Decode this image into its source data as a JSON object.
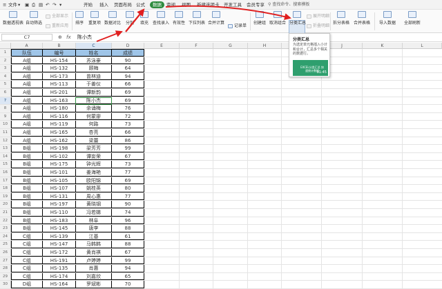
{
  "menubar": {
    "items": [
      "文件",
      "开始",
      "插入",
      "页面布局",
      "公式",
      "数据",
      "审阅",
      "视图",
      "新建选项卡",
      "开发工具",
      "会员专享"
    ],
    "active": "数据",
    "search_text": "查找命令、搜索模板"
  },
  "ribbon": {
    "buttons": [
      "数据透视表",
      "自动筛选",
      "全部显示",
      "重新应用",
      "排序",
      "重复项",
      "数据对比",
      "分列",
      "填充",
      "查找录入",
      "有效性",
      "下拉列表",
      "合并计算",
      "记录单",
      "创建组",
      "取消组合",
      "分类汇总",
      "展开明细",
      "折叠明细",
      "拆分表格",
      "合并表格",
      "导入数据",
      "全部刷新"
    ]
  },
  "formula": {
    "name_box": "C7",
    "fx": "fx",
    "value": "陈小杰"
  },
  "columns": [
    "A",
    "B",
    "C",
    "D",
    "E",
    "F",
    "G",
    "H",
    "I",
    "J",
    "K",
    "L"
  ],
  "table": {
    "headers": [
      "队伍",
      "编号",
      "姓名",
      "成绩"
    ],
    "rows": [
      [
        "A组",
        "HS-154",
        "苏泳豪",
        "90"
      ],
      [
        "A组",
        "HS-132",
        "顾梅",
        "64"
      ],
      [
        "A组",
        "HS-173",
        "曾林迪",
        "94"
      ],
      [
        "A组",
        "HS-113",
        "于姜仪",
        "66"
      ],
      [
        "A组",
        "HS-201",
        "谭新韵",
        "69"
      ],
      [
        "A组",
        "HS-163",
        "陈小杰",
        "69"
      ],
      [
        "A组",
        "HS-180",
        "余诵梅",
        "76"
      ],
      [
        "A组",
        "HS-116",
        "何蒙廖",
        "72"
      ],
      [
        "A组",
        "HS-119",
        "何路",
        "73"
      ],
      [
        "A组",
        "HS-165",
        "杏亮",
        "66"
      ],
      [
        "A组",
        "HS-162",
        "梁蕾",
        "86"
      ],
      [
        "B组",
        "HS-198",
        "梁芳芳",
        "99"
      ],
      [
        "B组",
        "HS-102",
        "谭妄荣",
        "67"
      ],
      [
        "B组",
        "HS-175",
        "钟光辉",
        "73"
      ],
      [
        "B组",
        "HS-101",
        "姜海艳",
        "77"
      ],
      [
        "B组",
        "HS-105",
        "欧阳锦",
        "69"
      ],
      [
        "B组",
        "HS-107",
        "姚桂英",
        "80"
      ],
      [
        "B组",
        "HS-131",
        "周心惠",
        "77"
      ],
      [
        "B组",
        "HS-197",
        "黄晓钢",
        "90"
      ],
      [
        "B组",
        "HS-110",
        "冯若娣",
        "74"
      ],
      [
        "B组",
        "HS-183",
        "林阜",
        "96"
      ],
      [
        "B组",
        "HS-145",
        "唐李",
        "88"
      ],
      [
        "C组",
        "HS-139",
        "江基",
        "61"
      ],
      [
        "C组",
        "HS-147",
        "马韩韩",
        "88"
      ],
      [
        "C组",
        "HS-172",
        "黄肖祺",
        "67"
      ],
      [
        "C组",
        "HS-191",
        "卢婷婷",
        "99"
      ],
      [
        "C组",
        "HS-135",
        "肖惠",
        "94"
      ],
      [
        "C组",
        "HS-174",
        "刘嘉欣",
        "65"
      ],
      [
        "D组",
        "HS-164",
        "罗斌彬",
        "70"
      ]
    ]
  },
  "row_numbers": [
    "1",
    "2",
    "3",
    "4",
    "5",
    "6",
    "7",
    "8",
    "9",
    "10",
    "11",
    "12",
    "13",
    "14",
    "15",
    "16",
    "17",
    "18",
    "19",
    "20",
    "21",
    "22",
    "23",
    "24",
    "25",
    "26",
    "27",
    "28",
    "29",
    "30"
  ],
  "tooltip": {
    "title": "分类汇总",
    "description": "为选定单元格插入小计和合计，汇总多个相关的数据行。",
    "video_title": "EXCEL分类汇总 快速统计数据",
    "duration": "01:45"
  },
  "colors": {
    "accent": "#2e8b3e",
    "header_fill": "#9fc5e8",
    "arrow": "#e02020"
  }
}
